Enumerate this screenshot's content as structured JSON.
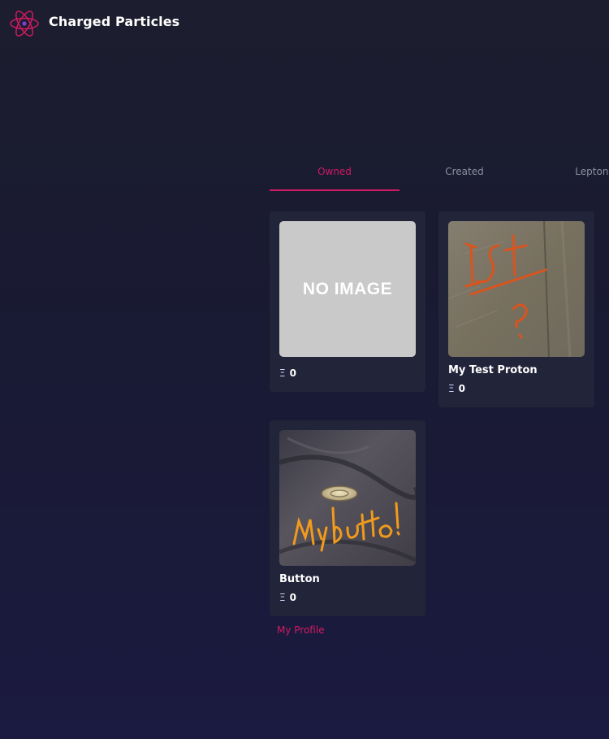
{
  "header": {
    "brand": "Charged Particles",
    "logo_icon": "atom-icon",
    "accent_color": "#d21a62"
  },
  "tabs": [
    {
      "label": "Owned",
      "active": true
    },
    {
      "label": "Created",
      "active": false
    },
    {
      "label": "Leptons",
      "active": false
    }
  ],
  "cards": [
    {
      "title": "",
      "image_text": "NO IMAGE",
      "image_type": "placeholder",
      "currency_symbol": "Ξ",
      "price": "0"
    },
    {
      "title": "My Test Proton",
      "image_type": "photo-handwriting",
      "image_caption": "1st?",
      "currency_symbol": "Ξ",
      "price": "0"
    },
    {
      "title": "Button",
      "image_type": "photo-button",
      "image_caption": "My button!",
      "currency_symbol": "Ξ",
      "price": "0"
    }
  ],
  "links": {
    "profile": "My Profile"
  }
}
